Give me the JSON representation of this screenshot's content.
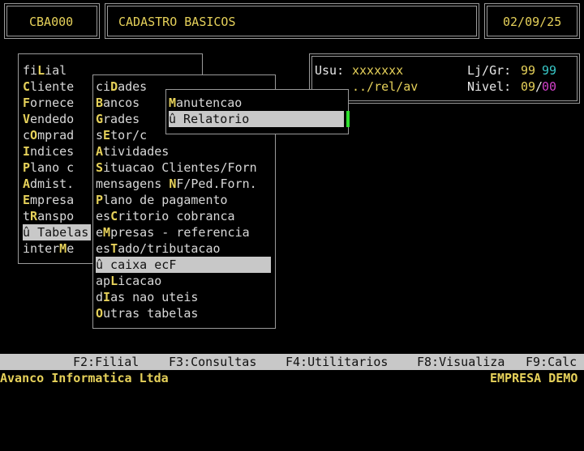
{
  "header": {
    "code": "CBA000",
    "title": "CADASTRO BASICOS",
    "date": "02/09/25"
  },
  "info": {
    "user_label": "Usu:",
    "user_value": "xxxxxxx",
    "store_label": "Lj/Gr:",
    "store_value": "99",
    "group_value": "99",
    "path": "../rel/av",
    "level_label": "Nivel:",
    "level_value": "09",
    "level_sub": "00"
  },
  "main_menu": [
    {
      "pre": "fi",
      "hk": "L",
      "post": "ial"
    },
    {
      "pre": "",
      "hk": "C",
      "post": "liente"
    },
    {
      "pre": "",
      "hk": "F",
      "post": "ornece"
    },
    {
      "pre": "",
      "hk": "V",
      "post": "endedo"
    },
    {
      "pre": "c",
      "hk": "O",
      "post": "mprad"
    },
    {
      "pre": "",
      "hk": "I",
      "post": "ndices"
    },
    {
      "pre": "",
      "hk": "P",
      "post": "lano c"
    },
    {
      "pre": "",
      "hk": "A",
      "post": "dmist."
    },
    {
      "pre": "",
      "hk": "E",
      "post": "mpresa"
    },
    {
      "pre": "t",
      "hk": "R",
      "post": "anspo"
    },
    {
      "pre": "û ",
      "hk": "",
      "post": "Tabelas"
    },
    {
      "pre": "inter",
      "hk": "M",
      "post": "e"
    }
  ],
  "tables_menu": [
    {
      "pre": "ci",
      "hk": "D",
      "post": "ades"
    },
    {
      "pre": "",
      "hk": "B",
      "post": "ancos"
    },
    {
      "pre": "",
      "hk": "G",
      "post": "rades"
    },
    {
      "pre": "s",
      "hk": "E",
      "post": "tor/c"
    },
    {
      "pre": "",
      "hk": "A",
      "post": "tividades"
    },
    {
      "pre": "",
      "hk": "S",
      "post": "ituacao Clientes/Forn"
    },
    {
      "pre": "mensagens ",
      "hk": "N",
      "post": "F/Ped.Forn."
    },
    {
      "pre": "",
      "hk": "P",
      "post": "lano de pagamento"
    },
    {
      "pre": "es",
      "hk": "C",
      "post": "ritorio cobranca"
    },
    {
      "pre": "e",
      "hk": "M",
      "post": "presas - referencia"
    },
    {
      "pre": "es",
      "hk": "T",
      "post": "ado/tributacao"
    },
    {
      "pre": "û caixa ec",
      "hk": "",
      "post": "F"
    },
    {
      "pre": "ap",
      "hk": "L",
      "post": "icacao"
    },
    {
      "pre": "d",
      "hk": "I",
      "post": "as nao uteis"
    },
    {
      "pre": "",
      "hk": "O",
      "post": "utras tabelas"
    }
  ],
  "sub_menu": [
    {
      "pre": "",
      "hk": "M",
      "post": "anutencao"
    },
    {
      "pre": "û Relatorio",
      "hk": "",
      "post": ""
    }
  ],
  "function_keys": [
    "F2:Filial",
    "F3:Consultas",
    "F4:Utilitarios",
    "F8:Visualiza",
    "F9:Calc"
  ],
  "footer": {
    "company": "Avanco Informatica Ltda",
    "env": "EMPRESA DEMO"
  }
}
